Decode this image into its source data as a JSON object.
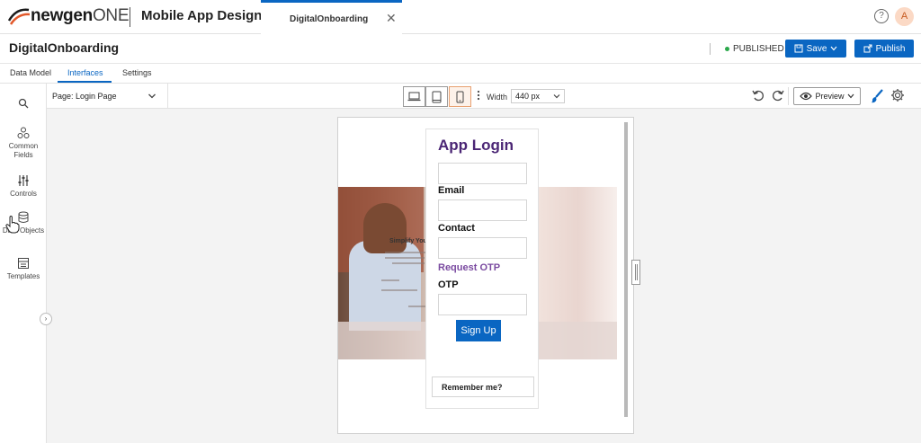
{
  "topbar": {
    "logo_brand": "newgen",
    "logo_suffix": "ONE",
    "app_title": "Mobile App Designer",
    "doc_tab": "DigitalOnboarding",
    "close_glyph": "✕",
    "help_glyph": "?",
    "avatar_initial": "A"
  },
  "header": {
    "page_title": "DigitalOnboarding",
    "status": "PUBLISHED",
    "status_color": "#2aa84a",
    "save_label": "Save",
    "publish_label": "Publish",
    "accent_color": "#0a66c2"
  },
  "nav_tabs": [
    {
      "label": "Data Model"
    },
    {
      "label": "Interfaces",
      "active": true
    },
    {
      "label": "Settings"
    }
  ],
  "sidebar": {
    "items": [
      {
        "label": "",
        "icon": "search-icon"
      },
      {
        "label": "Common Fields",
        "icon": "common-fields-icon"
      },
      {
        "label": "Controls",
        "icon": "controls-icon"
      },
      {
        "label": "Data Objects",
        "icon": "database-icon"
      },
      {
        "label": "Templates",
        "icon": "templates-icon"
      }
    ],
    "toggle_glyph": "›"
  },
  "toolbar": {
    "page_select": "Page: Login Page",
    "width_label": "Width",
    "width_value": "440 px",
    "preview_label": "Preview",
    "devices": [
      "desktop-icon",
      "tablet-icon",
      "mobile-icon"
    ],
    "active_device": "mobile-icon"
  },
  "form": {
    "title": "App Login",
    "fields": [
      "Email",
      "Contact"
    ],
    "otp_link": "Request OTP",
    "otp_label": "OTP",
    "signup_label": "Sign Up",
    "remember_label": "Remember me?",
    "title_color": "#4b2675",
    "link_color": "#7a4aa0"
  },
  "hero": {
    "headline": "Simplify Your"
  }
}
